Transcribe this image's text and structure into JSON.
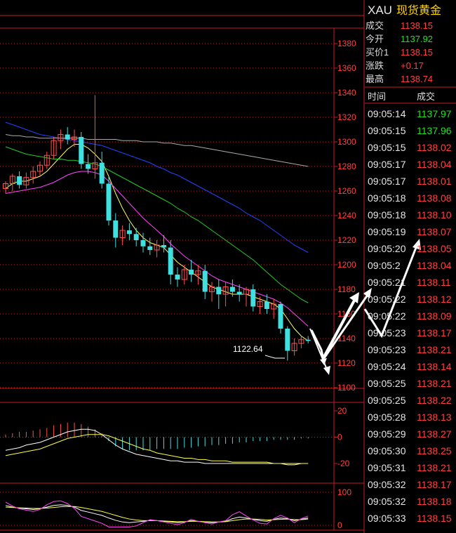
{
  "quote": {
    "symbol": "XAU",
    "name": "现货黄金",
    "rows": [
      {
        "label": "成交",
        "value": "1138.15",
        "color": "#ff4040"
      },
      {
        "label": "今开",
        "value": "1137.92",
        "color": "#20e020"
      },
      {
        "label": "买价1",
        "value": "1138.15",
        "color": "#ff4040"
      },
      {
        "label": "涨跌",
        "value": "+0.17",
        "color": "#ff4040"
      },
      {
        "label": "最高",
        "value": "1138.74",
        "color": "#ff4040"
      }
    ]
  },
  "ticks": {
    "header_time": "时间",
    "header_price": "成交",
    "rows": [
      {
        "time": "09:05:14",
        "price": "1137.97",
        "color": "#20e020"
      },
      {
        "time": "09:05:15",
        "price": "1137.96",
        "color": "#20e020"
      },
      {
        "time": "09:05:15",
        "price": "1138.02",
        "color": "#ff4040"
      },
      {
        "time": "09:05:17",
        "price": "1138.04",
        "color": "#ff4040"
      },
      {
        "time": "09:05:17",
        "price": "1138.01",
        "color": "#ff4040"
      },
      {
        "time": "09:05:18",
        "price": "1138.08",
        "color": "#ff4040"
      },
      {
        "time": "09:05:18",
        "price": "1138.10",
        "color": "#ff4040"
      },
      {
        "time": "09:05:19",
        "price": "1138.07",
        "color": "#ff4040"
      },
      {
        "time": "09:05:20",
        "price": "1138.05",
        "color": "#ff4040"
      },
      {
        "time": "09:05:2",
        "price": "1138.04",
        "color": "#ff4040"
      },
      {
        "time": "09:05:21",
        "price": "1138.11",
        "color": "#ff4040"
      },
      {
        "time": "09:05:22",
        "price": "1138.12",
        "color": "#ff4040"
      },
      {
        "time": "09:05:22",
        "price": "1138.09",
        "color": "#ff4040"
      },
      {
        "time": "09:05:23",
        "price": "1138.17",
        "color": "#ff4040"
      },
      {
        "time": "09:05:23",
        "price": "1138.21",
        "color": "#ff4040"
      },
      {
        "time": "09:05:24",
        "price": "1138.14",
        "color": "#ff4040"
      },
      {
        "time": "09:05:25",
        "price": "1138.21",
        "color": "#ff4040"
      },
      {
        "time": "09:05:25",
        "price": "1138.22",
        "color": "#ff4040"
      },
      {
        "time": "09:05:28",
        "price": "1138.13",
        "color": "#ff4040"
      },
      {
        "time": "09:05:29",
        "price": "1138.27",
        "color": "#ff4040"
      },
      {
        "time": "09:05:30",
        "price": "1138.25",
        "color": "#ff4040"
      },
      {
        "time": "09:05:31",
        "price": "1138.21",
        "color": "#ff4040"
      },
      {
        "time": "09:05:32",
        "price": "1138.17",
        "color": "#ff4040"
      },
      {
        "time": "09:05:32",
        "price": "1138.18",
        "color": "#ff4040"
      },
      {
        "time": "09:05:33",
        "price": "1138.15",
        "color": "#ff4040"
      }
    ]
  },
  "chart_data": {
    "type": "candlestick",
    "price_axis": {
      "ticks": [
        "1380",
        "1360",
        "1340",
        "1320",
        "1300",
        "1280",
        "1260",
        "1240",
        "1220",
        "1200",
        "1180",
        "1160",
        "1140",
        "1120",
        "1100"
      ],
      "range": [
        1100,
        1390
      ]
    },
    "annotation": "1122.64",
    "candles": [
      {
        "o": 1262,
        "h": 1268,
        "l": 1258,
        "c": 1266
      },
      {
        "o": 1266,
        "h": 1274,
        "l": 1260,
        "c": 1272
      },
      {
        "o": 1272,
        "h": 1276,
        "l": 1262,
        "c": 1265
      },
      {
        "o": 1265,
        "h": 1275,
        "l": 1262,
        "c": 1271
      },
      {
        "o": 1271,
        "h": 1280,
        "l": 1266,
        "c": 1276
      },
      {
        "o": 1276,
        "h": 1284,
        "l": 1272,
        "c": 1281
      },
      {
        "o": 1281,
        "h": 1292,
        "l": 1278,
        "c": 1289
      },
      {
        "o": 1289,
        "h": 1304,
        "l": 1286,
        "c": 1301
      },
      {
        "o": 1301,
        "h": 1310,
        "l": 1294,
        "c": 1306
      },
      {
        "o": 1306,
        "h": 1312,
        "l": 1298,
        "c": 1302
      },
      {
        "o": 1302,
        "h": 1310,
        "l": 1296,
        "c": 1304
      },
      {
        "o": 1304,
        "h": 1308,
        "l": 1278,
        "c": 1282
      },
      {
        "o": 1282,
        "h": 1290,
        "l": 1274,
        "c": 1278
      },
      {
        "o": 1278,
        "h": 1338,
        "l": 1270,
        "c": 1283
      },
      {
        "o": 1283,
        "h": 1292,
        "l": 1262,
        "c": 1266
      },
      {
        "o": 1266,
        "h": 1272,
        "l": 1232,
        "c": 1236
      },
      {
        "o": 1236,
        "h": 1242,
        "l": 1214,
        "c": 1222
      },
      {
        "o": 1222,
        "h": 1232,
        "l": 1216,
        "c": 1228
      },
      {
        "o": 1228,
        "h": 1234,
        "l": 1220,
        "c": 1225
      },
      {
        "o": 1225,
        "h": 1230,
        "l": 1215,
        "c": 1220
      },
      {
        "o": 1220,
        "h": 1226,
        "l": 1210,
        "c": 1215
      },
      {
        "o": 1215,
        "h": 1222,
        "l": 1208,
        "c": 1212
      },
      {
        "o": 1212,
        "h": 1220,
        "l": 1206,
        "c": 1216
      },
      {
        "o": 1216,
        "h": 1224,
        "l": 1210,
        "c": 1214
      },
      {
        "o": 1214,
        "h": 1220,
        "l": 1184,
        "c": 1192
      },
      {
        "o": 1192,
        "h": 1198,
        "l": 1182,
        "c": 1188
      },
      {
        "o": 1188,
        "h": 1200,
        "l": 1184,
        "c": 1196
      },
      {
        "o": 1196,
        "h": 1204,
        "l": 1186,
        "c": 1192
      },
      {
        "o": 1192,
        "h": 1200,
        "l": 1184,
        "c": 1195
      },
      {
        "o": 1195,
        "h": 1200,
        "l": 1172,
        "c": 1178
      },
      {
        "o": 1178,
        "h": 1186,
        "l": 1170,
        "c": 1182
      },
      {
        "o": 1182,
        "h": 1188,
        "l": 1164,
        "c": 1176
      },
      {
        "o": 1176,
        "h": 1186,
        "l": 1166,
        "c": 1182
      },
      {
        "o": 1182,
        "h": 1188,
        "l": 1174,
        "c": 1178
      },
      {
        "o": 1178,
        "h": 1184,
        "l": 1170,
        "c": 1176
      },
      {
        "o": 1176,
        "h": 1182,
        "l": 1166,
        "c": 1180
      },
      {
        "o": 1180,
        "h": 1184,
        "l": 1162,
        "c": 1166
      },
      {
        "o": 1166,
        "h": 1174,
        "l": 1160,
        "c": 1170
      },
      {
        "o": 1170,
        "h": 1176,
        "l": 1160,
        "c": 1164
      },
      {
        "o": 1164,
        "h": 1172,
        "l": 1156,
        "c": 1168
      },
      {
        "o": 1168,
        "h": 1170,
        "l": 1144,
        "c": 1148
      },
      {
        "o": 1148,
        "h": 1150,
        "l": 1122,
        "c": 1130
      },
      {
        "o": 1130,
        "h": 1140,
        "l": 1126,
        "c": 1136
      },
      {
        "o": 1136,
        "h": 1142,
        "l": 1132,
        "c": 1139
      },
      {
        "o": 1139,
        "h": 1142,
        "l": 1136,
        "c": 1138
      }
    ],
    "ma": [
      {
        "color": "#ffff66",
        "values": [
          1262,
          1266,
          1268,
          1268,
          1270,
          1272,
          1276,
          1282,
          1288,
          1294,
          1298,
          1298,
          1295,
          1290,
          1284,
          1272,
          1258,
          1246,
          1236,
          1228,
          1222,
          1218,
          1216,
          1214,
          1208,
          1202,
          1198,
          1194,
          1190,
          1186,
          1182,
          1180,
          1178,
          1176,
          1176,
          1176,
          1174,
          1172,
          1170,
          1168,
          1164,
          1156,
          1148,
          1142,
          1138
        ]
      },
      {
        "color": "#ff44ff",
        "values": [
          1258,
          1259,
          1260,
          1261,
          1262,
          1263,
          1265,
          1267,
          1270,
          1273,
          1275,
          1276,
          1276,
          1275,
          1273,
          1268,
          1262,
          1256,
          1250,
          1244,
          1238,
          1233,
          1228,
          1223,
          1217,
          1212,
          1207,
          1203,
          1199,
          1195,
          1191,
          1188,
          1186,
          1184,
          1182,
          1180,
          1178,
          1176,
          1174,
          1172,
          1169,
          1165,
          1160,
          1155,
          1150
        ]
      },
      {
        "color": "#22cc22",
        "values": [
          1296,
          1294,
          1292,
          1290,
          1289,
          1288,
          1287,
          1286,
          1286,
          1285,
          1285,
          1284,
          1283,
          1282,
          1280,
          1277,
          1274,
          1271,
          1268,
          1265,
          1262,
          1259,
          1256,
          1253,
          1250,
          1246,
          1243,
          1239,
          1236,
          1232,
          1228,
          1224,
          1220,
          1216,
          1212,
          1208,
          1204,
          1199,
          1194,
          1189,
          1184,
          1180,
          1176,
          1172,
          1169
        ]
      },
      {
        "color": "#2244ff",
        "values": [
          1316,
          1314,
          1312,
          1310,
          1308,
          1306,
          1305,
          1304,
          1303,
          1302,
          1301,
          1300,
          1299,
          1298,
          1297,
          1295,
          1293,
          1291,
          1289,
          1287,
          1285,
          1283,
          1280,
          1278,
          1275,
          1273,
          1270,
          1267,
          1264,
          1261,
          1258,
          1255,
          1252,
          1249,
          1246,
          1242,
          1239,
          1236,
          1232,
          1228,
          1224,
          1220,
          1216,
          1213,
          1210
        ]
      },
      {
        "color": "#aaaaaa",
        "values": [
          1306,
          1305,
          1305,
          1304,
          1304,
          1303,
          1303,
          1303,
          1303,
          1303,
          1303,
          1303,
          1302,
          1302,
          1302,
          1302,
          1302,
          1301,
          1301,
          1301,
          1300,
          1300,
          1300,
          1299,
          1299,
          1298,
          1297,
          1297,
          1296,
          1295,
          1294,
          1293,
          1292,
          1291,
          1290,
          1289,
          1288,
          1287,
          1286,
          1285,
          1284,
          1283,
          1282,
          1281,
          1280
        ]
      }
    ],
    "macd": {
      "axis_ticks": [
        "20",
        "0",
        "-20"
      ],
      "range": [
        -24,
        24
      ],
      "bars": [
        2,
        3,
        4,
        4,
        5,
        6,
        7,
        9,
        10,
        11,
        11,
        10,
        8,
        6,
        3,
        -3,
        -7,
        -9,
        -10,
        -10,
        -10,
        -10,
        -9,
        -9,
        -9,
        -9,
        -8,
        -8,
        -7,
        -7,
        -6,
        -6,
        -5,
        -5,
        -4,
        -4,
        -3,
        -3,
        -3,
        -2,
        -2,
        -2,
        -2,
        -1,
        -1
      ],
      "dif": [
        -10,
        -9,
        -8,
        -6,
        -5,
        -4,
        -2,
        0,
        2,
        4,
        5,
        6,
        6,
        5,
        2,
        -2,
        -6,
        -9,
        -11,
        -13,
        -14,
        -15,
        -16,
        -17,
        -18,
        -18,
        -19,
        -19,
        -19,
        -20,
        -20,
        -20,
        -20,
        -20,
        -20,
        -20,
        -20,
        -20,
        -20,
        -20,
        -20,
        -21,
        -21,
        -20,
        -20
      ],
      "dea": [
        -14,
        -13,
        -12,
        -11,
        -10,
        -9,
        -7,
        -5,
        -3,
        -1,
        0,
        1,
        2,
        2,
        2,
        1,
        -1,
        -3,
        -5,
        -7,
        -9,
        -10,
        -12,
        -13,
        -14,
        -15,
        -16,
        -16,
        -17,
        -17,
        -18,
        -18,
        -18,
        -19,
        -19,
        -19,
        -19,
        -19,
        -19,
        -20,
        -20,
        -20,
        -20,
        -20,
        -20
      ]
    },
    "kdj": {
      "axis_ticks": [
        "100",
        "0"
      ],
      "range": [
        0,
        100
      ],
      "k": [
        60,
        55,
        52,
        50,
        48,
        50,
        55,
        60,
        62,
        60,
        55,
        45,
        40,
        35,
        30,
        22,
        15,
        10,
        8,
        10,
        12,
        15,
        14,
        12,
        10,
        8,
        10,
        14,
        12,
        10,
        8,
        10,
        12,
        20,
        25,
        22,
        18,
        14,
        12,
        18,
        22,
        20,
        14,
        18,
        22
      ],
      "d": [
        55,
        54,
        53,
        52,
        51,
        51,
        52,
        54,
        56,
        57,
        57,
        54,
        50,
        46,
        42,
        36,
        30,
        24,
        19,
        16,
        14,
        14,
        14,
        13,
        12,
        11,
        11,
        12,
        12,
        11,
        10,
        10,
        11,
        14,
        17,
        19,
        19,
        18,
        16,
        17,
        18,
        19,
        17,
        17,
        19
      ],
      "j": [
        70,
        58,
        50,
        46,
        42,
        48,
        62,
        72,
        74,
        66,
        51,
        27,
        20,
        13,
        6,
        -6,
        -15,
        -18,
        -14,
        -2,
        8,
        17,
        14,
        10,
        6,
        2,
        8,
        18,
        12,
        8,
        4,
        10,
        14,
        32,
        41,
        28,
        16,
        6,
        4,
        20,
        30,
        22,
        8,
        20,
        28
      ]
    }
  }
}
